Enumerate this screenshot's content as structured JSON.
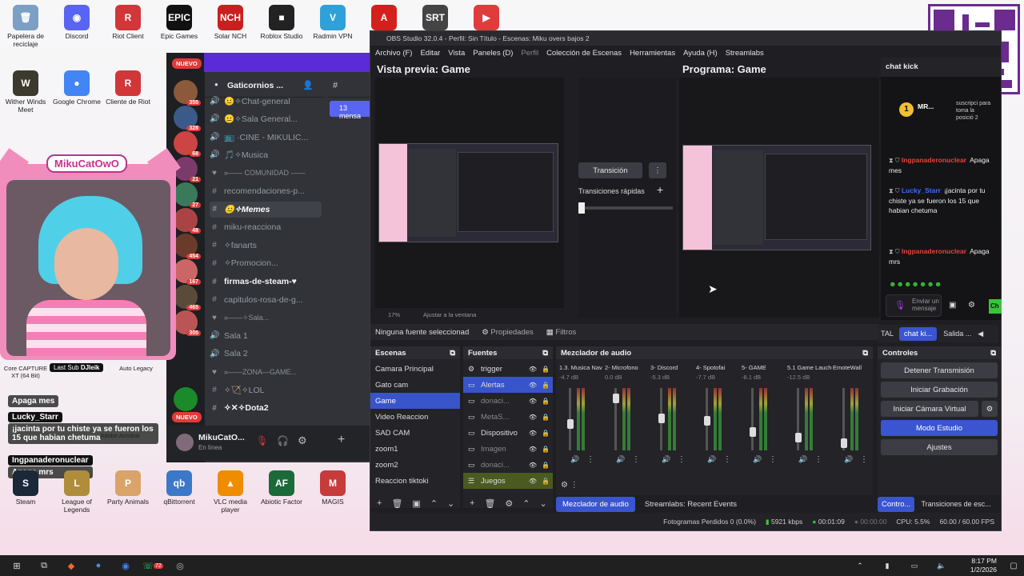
{
  "desktop": {
    "icons": [
      {
        "label": "Papelera de reciclaje",
        "color": "#7b9fc5",
        "glyph": "🗑"
      },
      {
        "label": "Discord",
        "color": "#5865f2",
        "glyph": "◉"
      },
      {
        "label": "Riot Client",
        "color": "#d13639",
        "glyph": "R"
      },
      {
        "label": "Epic Games",
        "color": "#111",
        "glyph": "EPIC"
      },
      {
        "label": "Solar NCH",
        "color": "#c82020",
        "glyph": "NCH"
      },
      {
        "label": "Roblox Studio",
        "color": "#222",
        "glyph": "■"
      },
      {
        "label": "Radmin VPN",
        "color": "#30a0d8",
        "glyph": "V"
      },
      {
        "label": "",
        "color": "#d3201d",
        "glyph": "A"
      },
      {
        "label": "",
        "color": "#444",
        "glyph": "SRT"
      },
      {
        "label": "",
        "color": "#e03c3c",
        "glyph": "▶"
      },
      {
        "label": "Wither Winds Meet",
        "color": "#3b3a2d",
        "glyph": "W"
      },
      {
        "label": "Google Chrome",
        "color": "#4285f4",
        "glyph": "●"
      },
      {
        "label": "Cliente de Riot",
        "color": "#d13639",
        "glyph": "R"
      }
    ],
    "bottom_icons": [
      {
        "label": "Steam",
        "color": "#1b2838",
        "glyph": "S"
      },
      {
        "label": "League of Legends",
        "color": "#b08d3a",
        "glyph": "L"
      },
      {
        "label": "Party Animals",
        "color": "#d9a36a",
        "glyph": "P"
      },
      {
        "label": "qBittorrent",
        "color": "#3b78c8",
        "glyph": "qb"
      },
      {
        "label": "VLC media player",
        "color": "#f08c00",
        "glyph": "▲"
      },
      {
        "label": "Abiotic Factor",
        "color": "#1b6a3a",
        "glyph": "AF"
      },
      {
        "label": "MAGIS",
        "color": "#c83b3b",
        "glyph": "M"
      }
    ],
    "extra": [
      "Core CAPTURE XT (64 Bit)",
      "Auto Legacy",
      "Adobe Acrobat"
    ]
  },
  "overlay": {
    "cam_name": "MikuCatOwO",
    "last_sub_label": "Last Sub",
    "last_sub_user": "DJleik",
    "chat": [
      {
        "user": "",
        "text": "Apaga mes",
        "color": "#222"
      },
      {
        "user": "Lucky_Starr",
        "text": "¡jacinta por tu chiste ya se fueron los 15 que habian chetuma",
        "color": "#1a8cff"
      },
      {
        "user": "Ingpanaderonuclear",
        "text": "Apaga mrs",
        "color": "#e9403d"
      }
    ]
  },
  "discord": {
    "server": "Gaticornios ...",
    "badge_new": "NUEVO",
    "badges": [
      "355",
      "328",
      "68",
      "21",
      "27",
      "48",
      "454",
      "167",
      "465",
      "305"
    ],
    "channels": [
      {
        "label": "😐✧Chat-general",
        "type": "voice"
      },
      {
        "label": "😐✧Sala General...",
        "type": "voice"
      },
      {
        "label": "📺 ·CINE - MIKULIC...",
        "type": "voice"
      },
      {
        "label": "🎵✧Musica",
        "type": "voice"
      },
      {
        "label": "»—— COMUNIDAD ——",
        "type": "cat"
      },
      {
        "label": "recomendaciones-p...",
        "type": "text"
      },
      {
        "label": "😐✧Memes",
        "type": "text-sel"
      },
      {
        "label": "miku-reacciona",
        "type": "text"
      },
      {
        "label": "✧fanarts",
        "type": "text"
      },
      {
        "label": "✧Promocion...",
        "type": "text"
      },
      {
        "label": "firmas-de-steam-♥",
        "type": "text-bold"
      },
      {
        "label": "capitulos-rosa-de-g...",
        "type": "text"
      },
      {
        "label": "»——✧Sala...",
        "type": "cat"
      },
      {
        "label": "Sala 1",
        "type": "voice"
      },
      {
        "label": "Sala 2",
        "type": "voice"
      },
      {
        "label": "»——ZONA—GAME...",
        "type": "cat"
      },
      {
        "label": "✧🏹✧LOL",
        "type": "text"
      },
      {
        "label": "✧✕✧Dota2",
        "type": "text-bold"
      }
    ],
    "mentions": "13 mensa",
    "user": {
      "name": "MikuCatO...",
      "status": "En línea"
    }
  },
  "obs": {
    "title": "OBS Studio 32.0.4 - Perfil: Sin Título - Escenas: Miku overs bajos 2",
    "menu": [
      "Archivo (F)",
      "Editar",
      "Vista",
      "Paneles (D)",
      "Perfil",
      "Colección de Escenas",
      "Herramientas",
      "Ayuda (H)",
      "Streamlabs"
    ],
    "preview_title": "Vista previa: Game",
    "program_title": "Programa: Game",
    "zoom": "17%",
    "fit": "Ajustar a la ventana",
    "transition_btn": "Transición",
    "quick_transitions": "Transiciones rápidas",
    "no_source": "Ninguna fuente seleccionad",
    "properties": "Propiedades",
    "filters": "Filtros",
    "scenes_title": "Escenas",
    "scenes": [
      "Camara Principal",
      "Gato cam",
      "Game",
      "Video Reaccion",
      "SAD CAM",
      "zoom1",
      "zoom2",
      "Reaccion tiktoki"
    ],
    "selected_scene": "Game",
    "sources_title": "Fuentes",
    "sources": [
      {
        "name": "trigger"
      },
      {
        "name": "Alertas"
      },
      {
        "name": "donaci..."
      },
      {
        "name": "MetaS..."
      },
      {
        "name": "Dispositivo"
      },
      {
        "name": "Imagen"
      },
      {
        "name": "donaci..."
      },
      {
        "name": "Juegos"
      }
    ],
    "mixer_title": "Mezclador de audio",
    "channels": [
      {
        "name": "1.3. Musica Nav Op",
        "db": "-4.7 dB",
        "level": 0.45
      },
      {
        "name": "2- Microfono",
        "db": "0.0 dB",
        "level": 0.9
      },
      {
        "name": "3- Discord",
        "db": "-5.3 dB",
        "level": 0.55
      },
      {
        "name": "4- Spotofai",
        "db": "-7.7 dB",
        "level": 0.5
      },
      {
        "name": "5- GAME",
        "db": "-8.1 dB",
        "level": 0.3
      },
      {
        "name": "5.1 Game Lauchers",
        "db": "-12.5 dB",
        "level": 0.2
      },
      {
        "name": "EmoteWall",
        "db": "",
        "level": 0.1
      }
    ],
    "meter_scale": [
      "0",
      "-5",
      "-10",
      "-15",
      "-20",
      "-25",
      "-30",
      "-35",
      "-40",
      "-45",
      "-50",
      "-55",
      "-60"
    ],
    "controls_title": "Controles",
    "controls": [
      "Detener Transmisión",
      "Iniciar Grabación",
      "Iniciar Cámara Virtual",
      "Modo Estudio",
      "Ajustes"
    ],
    "bottom_tabs": [
      "Mezclador de audio",
      "Streamlabs: Recent Events"
    ],
    "right_tabs": [
      "Contro...",
      "Transiciones de esc..."
    ],
    "chat_tabs": [
      "TAL",
      "chat ki...",
      "Salida ..."
    ],
    "status": {
      "dropped": "Fotogramas Perdidos 0 (0.0%)",
      "kbps": "5921 kbps",
      "stream_time": "00:01:09",
      "rec_time": "00:00:00",
      "cpu": "CPU: 5.5%",
      "fps": "60.00 / 60.00 FPS"
    }
  },
  "chat_kick": {
    "title": "chat kick",
    "top_user": "MR...",
    "top_text": "suscripci para toma la posició 2",
    "messages": [
      {
        "user": "Ingpanaderonuclear",
        "text": "Apaga mes",
        "color": "#e9403d"
      },
      {
        "user": "Lucky_Starr",
        "text": "¡jacinta por tu chiste ya se fueron los 15 que habian chetuma",
        "color": "#3d6bff"
      },
      {
        "user": "Ingpanaderonuclear",
        "text": "Apaga mrs",
        "color": "#e9403d"
      }
    ],
    "input_placeholder": "Enviar un mensaje",
    "chat_btn": "Ch"
  },
  "taskbar": {
    "time": "8:17 PM",
    "date": "1/2/2026",
    "badge": "72"
  },
  "colors": {
    "accent": "#3a55cf",
    "discord_bg": "#313338",
    "obs_bg": "#1f1f23",
    "yape": "#6b2b8f"
  }
}
